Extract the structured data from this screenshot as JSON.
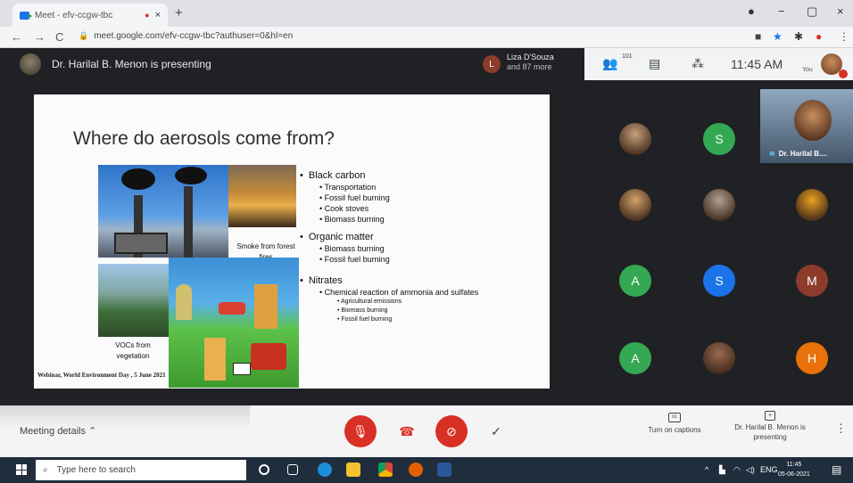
{
  "browser": {
    "tab_title": "Meet - efv-ccgw-tbc",
    "tab_close": "×",
    "new_tab": "+",
    "window_controls": [
      "●",
      "−",
      "▢",
      "×"
    ],
    "url": "meet.google.com/efv-ccgw-tbc?authuser=0&hl=en",
    "nav": {
      "back": "←",
      "forward": "→",
      "reload": "C"
    }
  },
  "meet": {
    "presenter_text": "Dr. Harilal B. Menon is presenting",
    "liza": {
      "initial": "L",
      "name": "Liza D'Souza",
      "more": "and 87 more"
    },
    "participant_count": "101",
    "clock": "11:45 AM",
    "you_label": "You",
    "self_tile_label": "Dr. Harilal B...."
  },
  "slide": {
    "title": "Where do aerosols come from?",
    "caption_smoke": "Smoke from forest fires",
    "caption_vocs": "VOCs from vegetation",
    "footer": "Webinar, World Environment Day , 5 June 2021",
    "bullets": [
      {
        "heading": "Black carbon",
        "items": [
          "Transportation",
          "Fossil fuel burning",
          "Cook stoves",
          "Biomass burning"
        ]
      },
      {
        "heading": "Organic matter",
        "items": [
          "Biomass burning",
          "Fossil fuel burning"
        ]
      },
      {
        "heading": "Nitrates",
        "items": [
          "Chemical reaction of ammonia and sulfates"
        ],
        "subitems": [
          "Agricultural emissions",
          "Biomass burning",
          "Fossil fuel burning"
        ]
      }
    ]
  },
  "participants": [
    {
      "initial": "",
      "color": "#c8a07a",
      "kind": "photo"
    },
    {
      "initial": "S",
      "color": "#34a853",
      "kind": "letter"
    },
    {
      "initial": "",
      "color": "#d4a06a",
      "kind": "photo"
    },
    {
      "initial": "",
      "color": "#b0a090",
      "kind": "photo"
    },
    {
      "initial": "",
      "color": "#e8a020",
      "kind": "photo"
    },
    {
      "initial": "A",
      "color": "#34a853",
      "kind": "letter"
    },
    {
      "initial": "S",
      "color": "#1a73e8",
      "kind": "letter"
    },
    {
      "initial": "M",
      "color": "#8d3b2b",
      "kind": "letter"
    },
    {
      "initial": "A",
      "color": "#34a853",
      "kind": "letter"
    },
    {
      "initial": "",
      "color": "#9a6a50",
      "kind": "photo"
    },
    {
      "initial": "H",
      "color": "#e8710a",
      "kind": "letter"
    }
  ],
  "controls": {
    "meeting_details": "Meeting details",
    "captions": "Turn on captions",
    "captions_icon": "cc",
    "presenting": "Dr. Harilal B. Menon is presenting",
    "presenting_icon": "+",
    "more": "⋮"
  },
  "taskbar": {
    "search_placeholder": "Type here to search",
    "time": "11:45",
    "date": "05-06-2021",
    "lang": "ENG"
  }
}
